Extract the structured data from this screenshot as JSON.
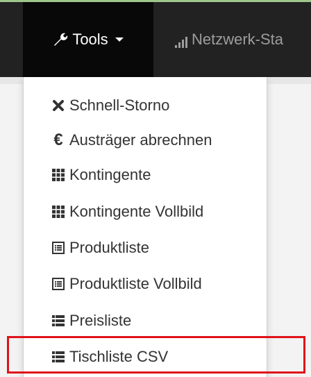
{
  "navbar": {
    "tools_label": "Tools",
    "netz_label": "Netzwerk-Sta"
  },
  "menu": {
    "items": [
      {
        "label": "Schnell-Storno",
        "icon": "close-icon"
      },
      {
        "label": "Austräger abrechnen",
        "icon": "euro-icon"
      },
      {
        "label": "Kontingente",
        "icon": "grid-icon"
      },
      {
        "label": "Kontingente Vollbild",
        "icon": "grid-icon"
      },
      {
        "label": "Produktliste",
        "icon": "list-alt-icon"
      },
      {
        "label": "Produktliste Vollbild",
        "icon": "list-alt-icon"
      },
      {
        "label": "Preisliste",
        "icon": "list-icon"
      },
      {
        "label": "Tischliste CSV",
        "icon": "list-icon"
      }
    ]
  },
  "colors": {
    "navbar_bg": "#222222",
    "active_tab_bg": "#080808",
    "highlight_border": "#e0121a"
  }
}
